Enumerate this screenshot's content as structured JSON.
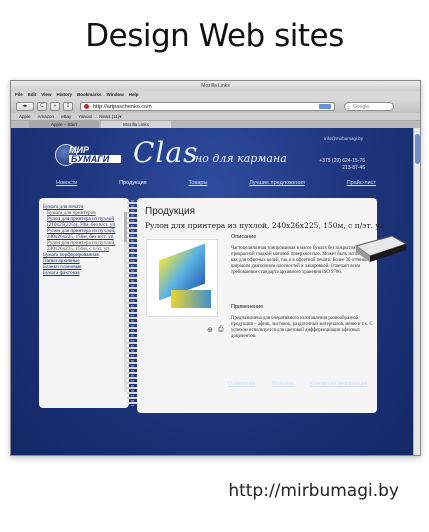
{
  "headline": "Design Web sites",
  "footer_url": "http://mirbumagi.by",
  "browser": {
    "window_title": "Mozilla Links",
    "menu": [
      "File",
      "Edit",
      "View",
      "History",
      "Bookmarks",
      "Window",
      "Help"
    ],
    "nav_buttons": [
      "◂▸",
      "C",
      "+",
      "↧"
    ],
    "url": "http://artpaschenko.com",
    "search_placeholder": "Google",
    "bookmarks": [
      "Apple",
      "Amazon",
      "eBay",
      "Yahoo!",
      "News (11)▾"
    ],
    "tabs": [
      {
        "label": "Apple – Start",
        "active": false
      },
      {
        "label": "Mozilla Links",
        "active": true
      }
    ]
  },
  "site": {
    "logo_line1": "МИР",
    "logo_line2": "БУМАГИ",
    "brand": "Clas",
    "tagline": "но для кармана",
    "email": "info@mirbumagi.by",
    "phones": [
      "+375 (29) 624-15-76",
      "213-87-46"
    ],
    "nav": [
      "Новости",
      "Продукция",
      "Товары",
      "Лучшие предложения",
      "Прайс-лист"
    ],
    "nav_active": "Продукция",
    "sidebar": [
      {
        "label": "Бумага для печати",
        "sub": false
      },
      {
        "label": "Бумага для принтеров",
        "sub": true
      },
      {
        "label": "Рулон для принтера из пухлой (210x25(225)), 70м, без в/ст. уп",
        "sub": true
      },
      {
        "label": "Рулон для принтера из пухлой, 240x26x225, 150м, без в/ст. уп",
        "sub": true
      },
      {
        "label": "Рулон для принтера из пухлой, 240x26x225, 150м, с п/эт. уп",
        "sub": true
      },
      {
        "label": "Бумага перфорированная",
        "sub": false
      },
      {
        "label": "Папки архивные",
        "sub": false
      },
      {
        "label": "Бланки плановые",
        "sub": false
      },
      {
        "label": "Бумага фактовая",
        "sub": false
      }
    ],
    "main_title": "Продукция",
    "product_title": "Рулон для принтера из пухлой, 240x26x225, 150м, с п/эт. уп",
    "description_heading": "Описание",
    "description_text": "Частоцелилозная тонированная в массе бумага без покрытия. Обладает прекрасной гладкой матовой поверхностью. Может быть использована как для офисных целей, так и в офсетной печати. Более 30 оттенков с широким диапазоном плотностей и лакировкой. Отвечает всем требованиям стандарта архивного хранения ISO 9706.",
    "application_heading": "Применение",
    "application_text": "Предназначена для оперативного изготовления разнообразной продукции – афиш, листовок, раздаточных материалов, меню и т.к. С успехом используется для цветовой дифференциации офисных документов.",
    "bottom_nav": [
      "О компании",
      "Полезное",
      "Контактная информация"
    ]
  },
  "colors": {
    "page_bg": "#1f3780",
    "link": "#1c2f7a",
    "panel_bg": "#f5f5f5"
  }
}
